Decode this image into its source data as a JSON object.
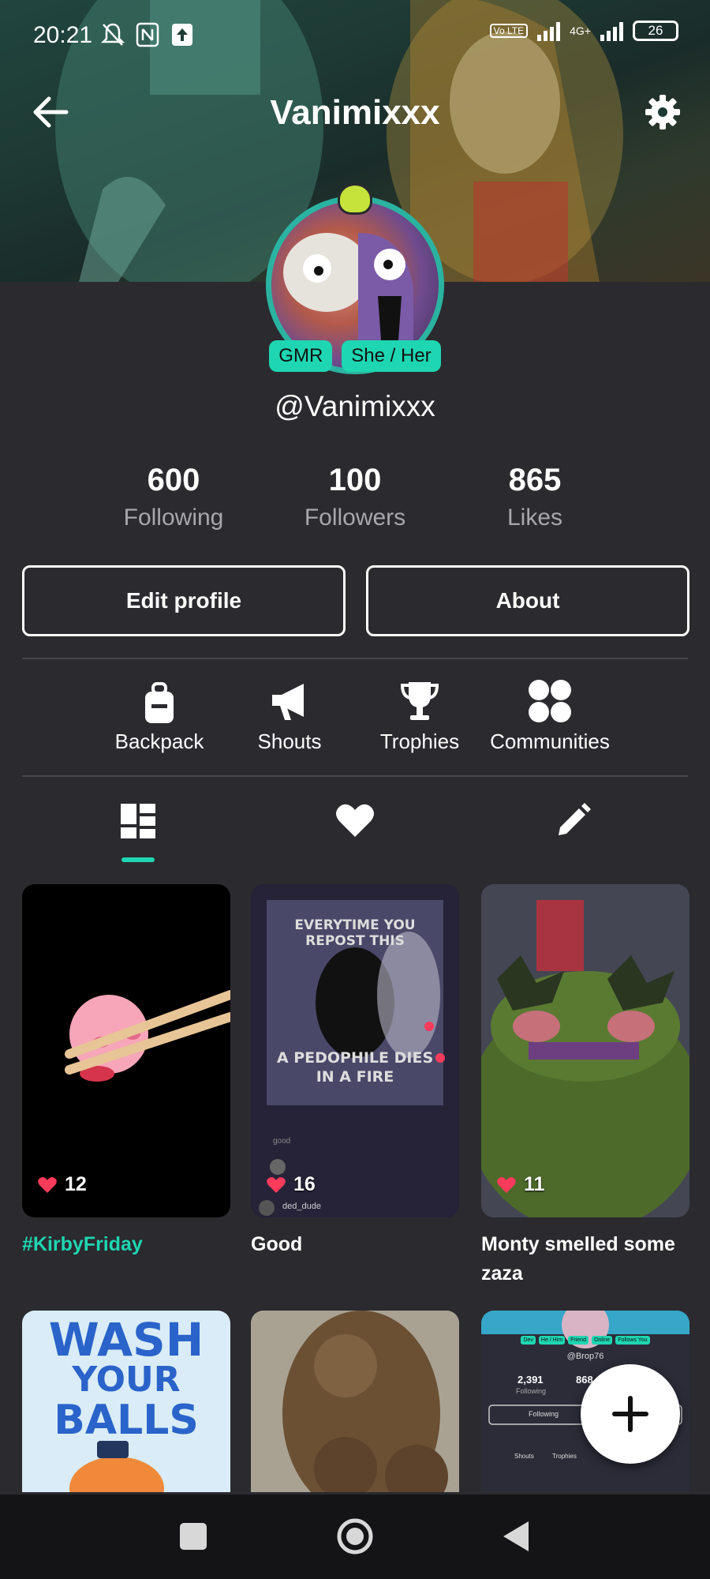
{
  "status_bar": {
    "time": "20:21",
    "network": "4G+",
    "battery": "26",
    "volte": "Vo LTE"
  },
  "header": {
    "title": "Vanimixxx"
  },
  "profile": {
    "tags": [
      "GMR",
      "She / Her"
    ],
    "handle": "@Vanimixxx",
    "stats": [
      {
        "value": "600",
        "label": "Following"
      },
      {
        "value": "100",
        "label": "Followers"
      },
      {
        "value": "865",
        "label": "Likes"
      }
    ]
  },
  "buttons": {
    "edit": "Edit profile",
    "about": "About"
  },
  "quick_links": [
    "Backpack",
    "Shouts",
    "Trophies",
    "Communities"
  ],
  "colors": {
    "accent": "#1ed6b2",
    "background": "#2a2a2f",
    "like": "#ff3b5c"
  },
  "posts": [
    {
      "likes": "12",
      "caption": "#KirbyFriday"
    },
    {
      "likes": "16",
      "caption": "Good",
      "image_text_top": "EVERYTIME YOU REPOST THIS",
      "image_text_bottom": "A PEDOPHILE DIES IN A FIRE",
      "image_user": "ded_dude",
      "image_comment": "good"
    },
    {
      "likes": "11",
      "caption": "Monty smelled some zaza"
    }
  ],
  "row2": {
    "wash_text": [
      "WASH",
      "YOUR",
      "BALLS"
    ],
    "mini_handle": "@Brop76",
    "mini_tags": [
      "Dev",
      "He / Him",
      "Friend",
      "Online",
      "Follows You"
    ],
    "mini_stat1": "2,391",
    "mini_stat1_label": "Following",
    "mini_stat2": "868",
    "mini_following": "Following",
    "mini_links": [
      "Shouts",
      "Trophies"
    ]
  }
}
